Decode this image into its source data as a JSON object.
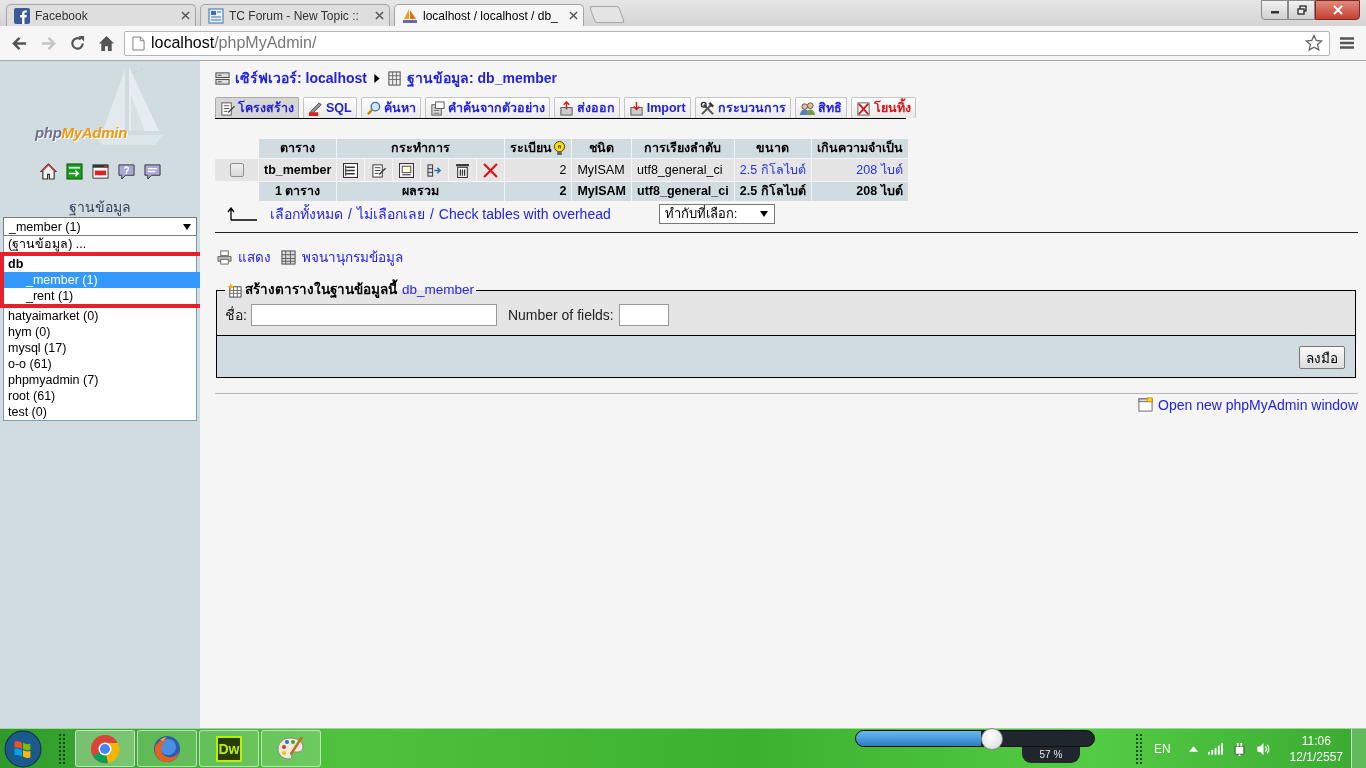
{
  "browser": {
    "tabs": [
      {
        "kind": "social",
        "title": "Facebook",
        "selected": false
      },
      {
        "kind": "forum",
        "title": "TC Forum - New Topic ::",
        "selected": false
      },
      {
        "kind": "database",
        "title": "localhost / localhost / db_",
        "selected": true
      }
    ],
    "nav": [
      {
        "kind": "back",
        "disabled": false
      },
      {
        "kind": "forward",
        "disabled": true
      },
      {
        "kind": "reload",
        "disabled": false
      },
      {
        "kind": "home",
        "disabled": false
      }
    ],
    "address": {
      "host": "localhost",
      "path": "/phpMyAdmin/"
    }
  },
  "sidebar": {
    "logo": {
      "prefix": "php",
      "name": "MyAdmin"
    },
    "database_label": "ฐานข้อมูล",
    "database_select": {
      "value": "_member (1)"
    },
    "databases": [
      {
        "kind": "option",
        "label": "(ฐานข้อมูล) ...",
        "selected": false
      },
      {
        "kind": "group",
        "label": "db",
        "children": [
          {
            "kind": "option",
            "label": "_member (1)",
            "selected": true
          },
          {
            "kind": "option",
            "label": "_rent (1)",
            "selected": false
          }
        ]
      },
      {
        "kind": "option",
        "label": "hatyaimarket (0)",
        "selected": false
      },
      {
        "kind": "option",
        "label": "hym (0)",
        "selected": false
      },
      {
        "kind": "option",
        "label": "mysql (17)",
        "selected": false
      },
      {
        "kind": "option",
        "label": "o-o (61)",
        "selected": false
      },
      {
        "kind": "option",
        "label": "phpmyadmin (7)",
        "selected": false
      },
      {
        "kind": "option",
        "label": "root (61)",
        "selected": false
      },
      {
        "kind": "option",
        "label": "test (0)",
        "selected": false
      }
    ]
  },
  "breadcrumb": [
    {
      "kind": "server",
      "label": "เซิร์ฟเวอร์: localhost"
    },
    {
      "kind": "database",
      "label": "ฐานข้อมูล: db_member"
    }
  ],
  "tabs": [
    {
      "kind": "structure",
      "label": "โครงสร้าง",
      "selected": true
    },
    {
      "kind": "sql",
      "label": "SQL",
      "selected": false
    },
    {
      "kind": "search",
      "label": "ค้นหา",
      "selected": false
    },
    {
      "kind": "query",
      "label": "คำค้นจากตัวอย่าง",
      "selected": false
    },
    {
      "kind": "export",
      "label": "ส่งออก",
      "selected": false
    },
    {
      "kind": "import",
      "label": "Import",
      "selected": false
    },
    {
      "kind": "operations",
      "label": "กระบวนการ",
      "selected": false
    },
    {
      "kind": "privileges",
      "label": "สิทธิ",
      "selected": false
    },
    {
      "kind": "drop",
      "label": "โยนทิ้ง",
      "selected": false
    }
  ],
  "table": {
    "columns": [
      "ตาราง",
      "กระทำการ",
      "ระเบียน",
      "ชนิด",
      "การเรียงลำดับ",
      "ขนาด",
      "เกินความจำเป็น"
    ],
    "rows": [
      {
        "checked": false,
        "name": "tb_member",
        "records": "2",
        "type": "MyISAM",
        "collation": "utf8_general_ci",
        "size": "2.5 กิโลไบต์",
        "overhead": "208 ไบต์"
      }
    ],
    "footer": {
      "tables": "1 ตาราง",
      "label": "ผลรวม",
      "records": "2",
      "type": "MyISAM",
      "collation": "utf8_general_ci",
      "size": "2.5 กิโลไบต์",
      "overhead": "208 ไบต์"
    }
  },
  "selection_links": [
    "เลือกทั้งหมด",
    "ไม่เลือกเลย",
    "Check tables with overhead"
  ],
  "link_separator": "/",
  "with_selected": {
    "value": "ทำกับที่เลือก:"
  },
  "tools": [
    {
      "kind": "print",
      "label": "แสดง"
    },
    {
      "kind": "dictionary",
      "label": "พจนานุกรมข้อมูล"
    }
  ],
  "create_table": {
    "legend": "สร้างตารางในฐานข้อมูลนี้",
    "database": "db_member",
    "name_label": "ชื่อ:",
    "fields_label": "Number of fields:",
    "button": "ลงมือ"
  },
  "new_window_link": "Open new phpMyAdmin window",
  "taskbar": {
    "apps": [
      {
        "kind": "chrome"
      },
      {
        "kind": "firefox"
      },
      {
        "kind": "dreamweaver",
        "label": "Dw"
      },
      {
        "kind": "paint"
      }
    ],
    "brightness": {
      "level": 0.57,
      "reading": "57 %"
    },
    "language": "EN",
    "time": "11:06",
    "date": "12/1/2557"
  }
}
